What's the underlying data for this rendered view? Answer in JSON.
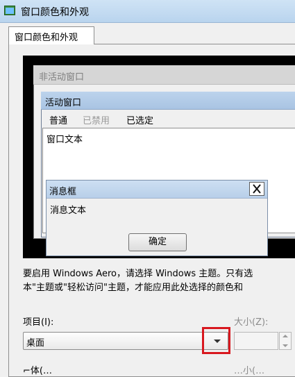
{
  "window": {
    "title": "窗口颜色和外观"
  },
  "tabs": [
    {
      "label": "窗口颜色和外观"
    }
  ],
  "preview": {
    "inactive_title": "非活动窗口",
    "active_title": "活动窗口",
    "menu": {
      "normal": "普通",
      "disabled": "已禁用",
      "selected": "已选定"
    },
    "window_text": "窗口文本",
    "message_box": {
      "title": "消息框",
      "text": "消息文本",
      "ok_label": "确定",
      "close_glyph": "✕"
    }
  },
  "info": {
    "line1": "要启用 Windows Aero，请选择 Windows 主题。只有选",
    "line2": "本\"主题或\"轻松访问\"主题，才能应用此处选择的颜色和"
  },
  "item": {
    "label": "项目(I):",
    "value": "桌面"
  },
  "size": {
    "label": "大小(Z):"
  },
  "clipped": {
    "left": "⌐体(…",
    "right": "…小(…"
  },
  "colors": {
    "highlight": "#d8181f",
    "active_title": "#bcd3ec"
  },
  "icons": [
    "app-window-icon",
    "close-icon",
    "chevron-down-icon",
    "spin-up-icon",
    "spin-down-icon"
  ]
}
